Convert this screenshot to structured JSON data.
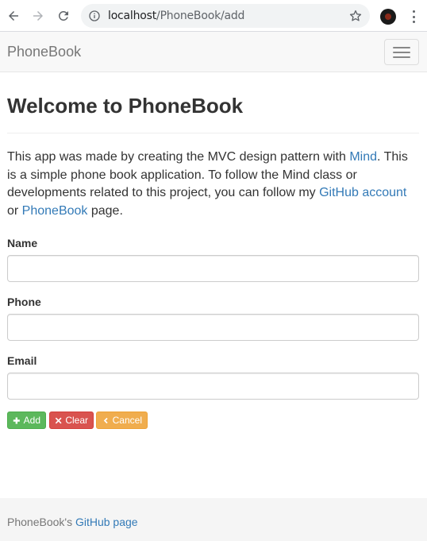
{
  "browser": {
    "url_host": "localhost",
    "url_path": "/PhoneBook/add"
  },
  "navbar": {
    "brand": "PhoneBook"
  },
  "main": {
    "heading": "Welcome to PhoneBook",
    "intro": {
      "part1": "This app was made by creating the MVC design pattern with ",
      "link_mind": "Mind",
      "part2": ". This is a simple phone book application. To follow the Mind class or developments related to this project, you can follow my ",
      "link_github": "GitHub account",
      "part3": " or ",
      "link_phonebook": "PhoneBook",
      "part4": " page."
    }
  },
  "form": {
    "name_label": "Name",
    "name_value": "",
    "phone_label": "Phone",
    "phone_value": "",
    "email_label": "Email",
    "email_value": "",
    "add_label": "Add",
    "clear_label": "Clear",
    "cancel_label": "Cancel"
  },
  "footer": {
    "prefix": "PhoneBook's ",
    "link": "GitHub page"
  },
  "colors": {
    "link": "#337ab7",
    "add": "#5cb85c",
    "clear": "#d9534f",
    "cancel": "#f0ad4e"
  }
}
